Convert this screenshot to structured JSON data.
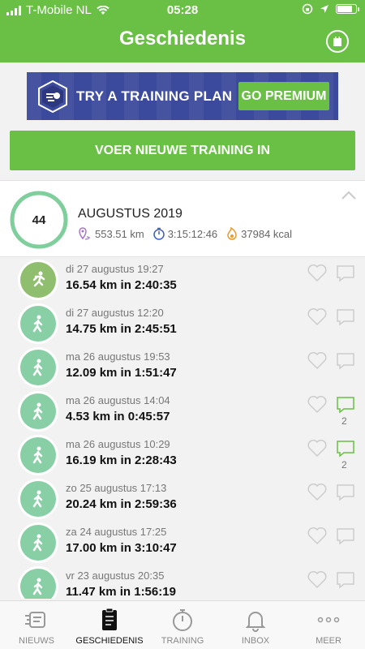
{
  "status": {
    "carrier": "T-Mobile NL",
    "time": "05:28"
  },
  "header": {
    "title": "Geschiedenis"
  },
  "banner": {
    "text": "TRY A TRAINING PLAN",
    "button": "GO PREMIUM"
  },
  "new_training_button": "VOER NIEUWE TRAINING IN",
  "month": {
    "count": "44",
    "name": "AUGUSTUS 2019",
    "distance": "553.51 km",
    "duration": "3:15:12:46",
    "calories": "37984 kcal"
  },
  "trainings": [
    {
      "date": "di 27 augustus 19:27",
      "summary": "16.54 km in 2:40:35",
      "type": "run",
      "comments": ""
    },
    {
      "date": "di 27 augustus 12:20",
      "summary": "14.75 km in 2:45:51",
      "type": "walk",
      "comments": ""
    },
    {
      "date": "ma 26 augustus 19:53",
      "summary": "12.09 km in 1:51:47",
      "type": "walk",
      "comments": ""
    },
    {
      "date": "ma 26 augustus 14:04",
      "summary": "4.53 km in 0:45:57",
      "type": "walk",
      "comments": "2"
    },
    {
      "date": "ma 26 augustus 10:29",
      "summary": "16.19 km in 2:28:43",
      "type": "walk",
      "comments": "2"
    },
    {
      "date": "zo 25 augustus 17:13",
      "summary": "20.24 km in 2:59:36",
      "type": "walk",
      "comments": ""
    },
    {
      "date": "za 24 augustus 17:25",
      "summary": "17.00 km in 3:10:47",
      "type": "walk",
      "comments": ""
    },
    {
      "date": "vr 23 augustus 20:35",
      "summary": "11.47 km in 1:56:19",
      "type": "walk",
      "comments": ""
    }
  ],
  "tabs": [
    {
      "label": "NIEUWS",
      "icon": "news-icon"
    },
    {
      "label": "GESCHIEDENIS",
      "icon": "clipboard-icon"
    },
    {
      "label": "TRAINING",
      "icon": "stopwatch-icon"
    },
    {
      "label": "INBOX",
      "icon": "bell-icon"
    },
    {
      "label": "MEER",
      "icon": "more-icon"
    }
  ],
  "colors": {
    "brand": "#6ac045",
    "banner": "#3b4a9c",
    "walk": "#88cfa5",
    "run": "#8fbe6e"
  }
}
